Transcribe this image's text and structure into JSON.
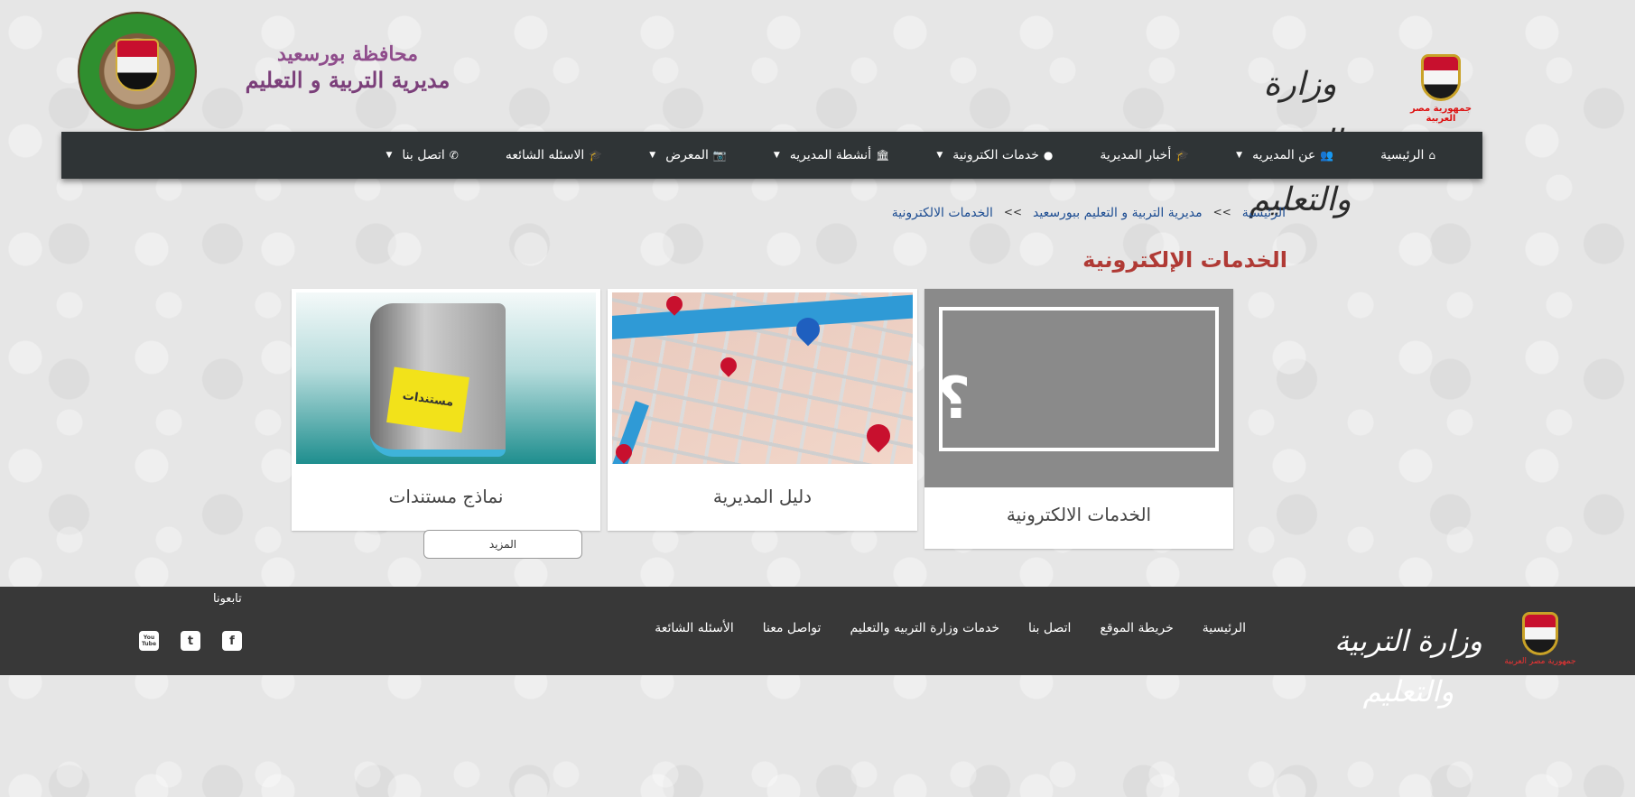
{
  "header": {
    "governorate_line1": "محافظة بورسعيد",
    "governorate_line2": "مديرية التربية و التعليم",
    "ministry_calligraphy": "وزارة التربية والتعليم",
    "emblem_caption": "جمهورية مصر العربية"
  },
  "nav": {
    "items": [
      {
        "label": "الرئيسية",
        "icon": "home-icon",
        "has_dropdown": false
      },
      {
        "label": "عن المديريه",
        "icon": "users-icon",
        "has_dropdown": true
      },
      {
        "label": "أخبار المديرية",
        "icon": "graduation-cap-icon",
        "has_dropdown": false
      },
      {
        "label": "خدمات الكترونية",
        "icon": "globe-icon",
        "has_dropdown": true
      },
      {
        "label": "أنشطة المديريه",
        "icon": "institution-icon",
        "has_dropdown": true
      },
      {
        "label": "المعرض",
        "icon": "camera-icon",
        "has_dropdown": true
      },
      {
        "label": "الاسئله الشائعه",
        "icon": "graduation-cap-icon",
        "has_dropdown": false
      },
      {
        "label": "اتصل بنا",
        "icon": "phone-icon",
        "has_dropdown": true
      }
    ]
  },
  "breadcrumb": {
    "home": "الرئيسية",
    "separator": ">>",
    "directorate": "مديرية التربية و التعليم ببورسعيد",
    "current": "الخدمات الالكترونية"
  },
  "page": {
    "title": "الخدمات الإلكترونية"
  },
  "cards": {
    "eservices": {
      "label": "الخدمات الالكترونية",
      "icon_glyph": "؟"
    },
    "guide": {
      "label": "دليل المديرية"
    },
    "docs": {
      "label": "نماذج مستندات",
      "sticky_text": "مستندات"
    }
  },
  "more_button": "المزيد",
  "footer": {
    "ministry_calligraphy": "وزارة التربية والتعليم",
    "emblem_caption": "جمهورية مصر العربية",
    "links": [
      "الرئيسية",
      "خريطة الموقع",
      "اتصل بنا",
      "خدمات وزارة التربيه والتعليم",
      "تواصل معنا",
      "الأسئله الشائعة"
    ],
    "follow_label": "تابعونا",
    "social": {
      "facebook": "f",
      "twitter": "t",
      "youtube": "You Tube"
    }
  },
  "colors": {
    "nav_bg": "#2f3436",
    "footer_bg": "#383838",
    "title": "#b03a35",
    "breadcrumb_link": "#1d4d92"
  }
}
